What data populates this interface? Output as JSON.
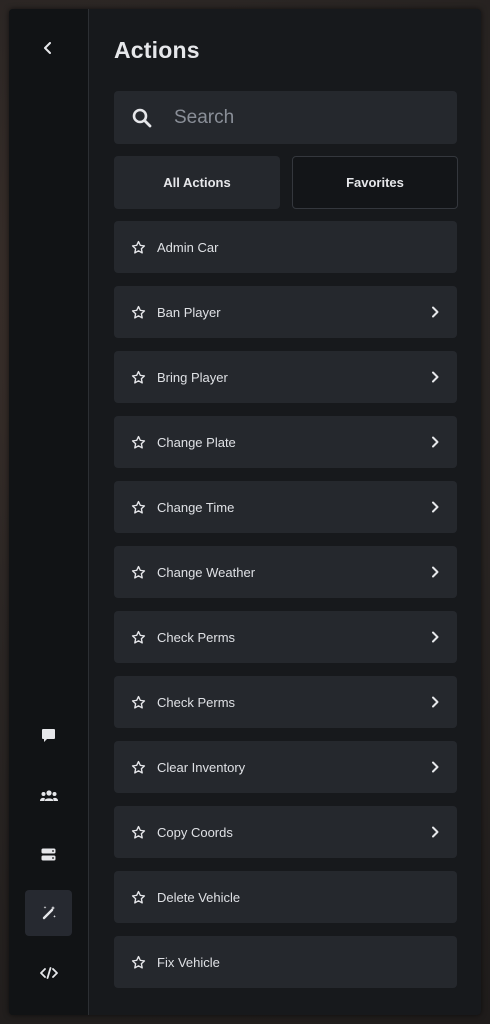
{
  "sidebar": {
    "back_icon": "chevron-left-icon",
    "items": [
      {
        "name": "chat",
        "icon": "message-icon"
      },
      {
        "name": "players",
        "icon": "users-icon"
      },
      {
        "name": "server",
        "icon": "server-icon"
      },
      {
        "name": "actions",
        "icon": "magic-wand-icon",
        "active": true
      },
      {
        "name": "dev",
        "icon": "code-icon"
      }
    ]
  },
  "header": {
    "title": "Actions"
  },
  "search": {
    "placeholder": "Search",
    "value": ""
  },
  "tabs": {
    "all_label": "All Actions",
    "favorites_label": "Favorites"
  },
  "actions": [
    {
      "label": "Admin Car",
      "has_submenu": false
    },
    {
      "label": "Ban Player",
      "has_submenu": true
    },
    {
      "label": "Bring Player",
      "has_submenu": true
    },
    {
      "label": "Change Plate",
      "has_submenu": true
    },
    {
      "label": "Change Time",
      "has_submenu": true
    },
    {
      "label": "Change Weather",
      "has_submenu": true
    },
    {
      "label": "Check Perms",
      "has_submenu": true
    },
    {
      "label": "Check Perms",
      "has_submenu": true
    },
    {
      "label": "Clear Inventory",
      "has_submenu": true
    },
    {
      "label": "Copy Coords",
      "has_submenu": true
    },
    {
      "label": "Delete Vehicle",
      "has_submenu": false
    },
    {
      "label": "Fix Vehicle",
      "has_submenu": false
    }
  ],
  "colors": {
    "panel_bg": "#17191c",
    "sidebar_bg": "#111315",
    "item_bg": "#25282d",
    "text": "#dfe1e5"
  }
}
